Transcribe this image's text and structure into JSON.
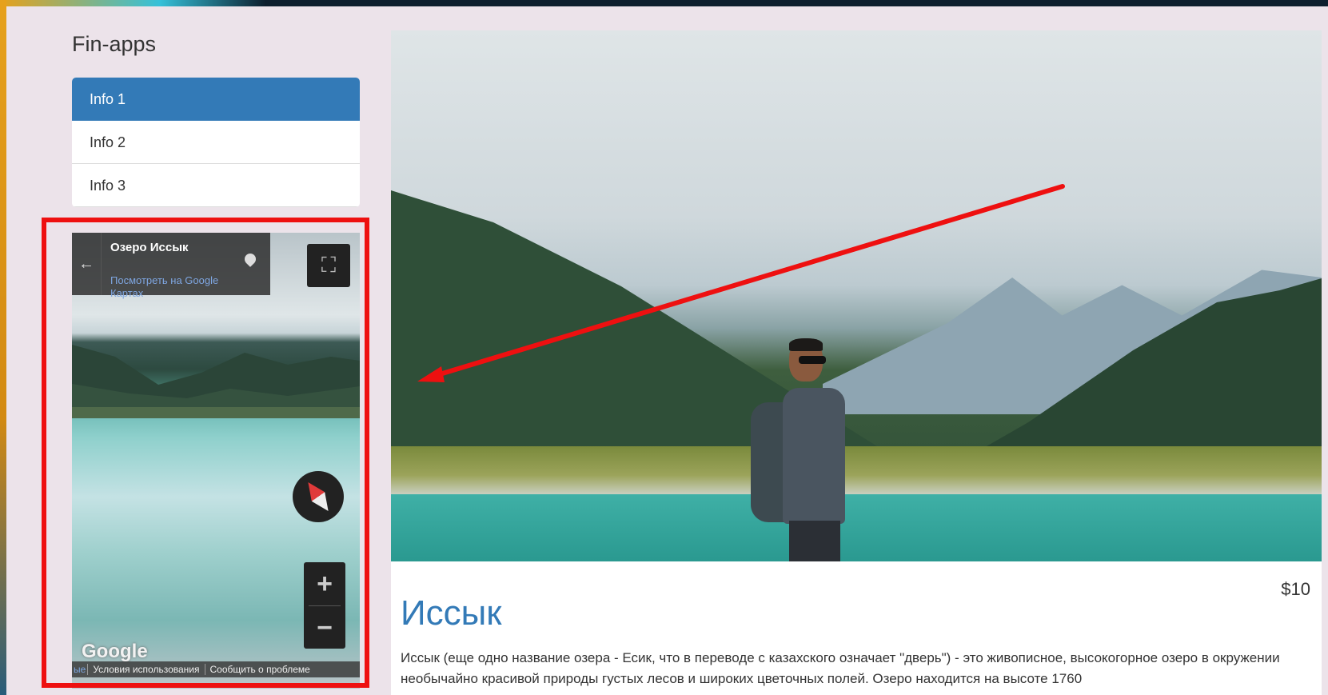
{
  "brand": "Fin-apps",
  "nav": {
    "items": [
      {
        "label": "Info 1",
        "active": true
      },
      {
        "label": "Info 2",
        "active": false
      },
      {
        "label": "Info 3",
        "active": false
      }
    ]
  },
  "map": {
    "place_name": "Озеро Иссык",
    "view_link": "Посмотреть на Google Картах",
    "google_logo": "Google",
    "footer_cut": "ые",
    "terms": "Условия использования",
    "report": "Сообщить о проблеме",
    "back_icon": "←",
    "fullscreen_icon": "⛶",
    "zoom_in": "+",
    "zoom_out": "−"
  },
  "product": {
    "title": "Иссык",
    "price": "$10",
    "description": "Иссык (еще одно название озера - Есик, что в переводе с казахского означает \"дверь\") - это живописное, высокогорное озеро в окружении необычайно красивой природы густых лесов и широких цветочных полей. Озеро находится на высоте 1760"
  },
  "colors": {
    "accent": "#337ab7",
    "annotation_red": "#ee1010",
    "background": "#ece3ea"
  }
}
